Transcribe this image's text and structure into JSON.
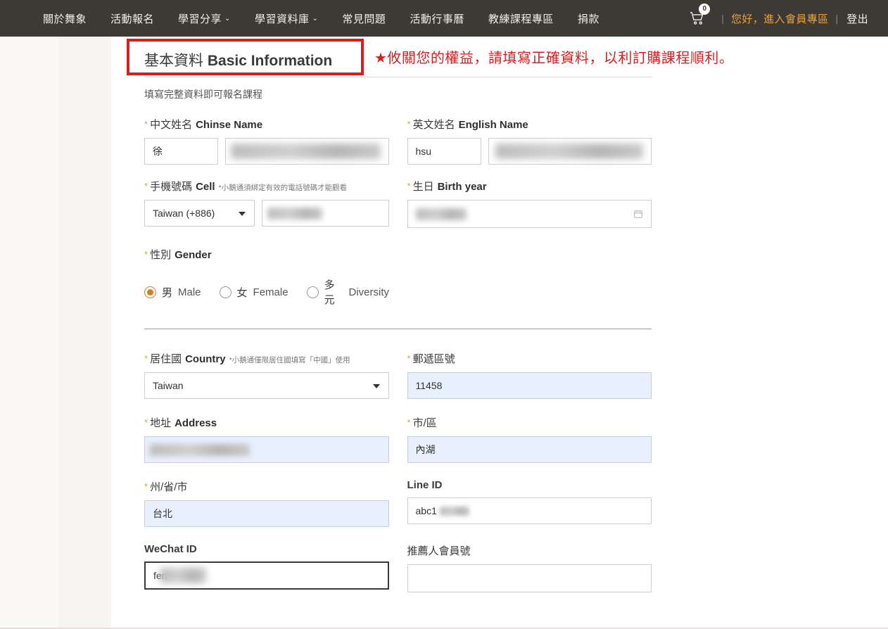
{
  "nav": {
    "items": [
      {
        "label": "關於舞象",
        "caret": false
      },
      {
        "label": "活動報名",
        "caret": false
      },
      {
        "label": "學習分享",
        "caret": true
      },
      {
        "label": "學習資料庫",
        "caret": true
      },
      {
        "label": "常見問題",
        "caret": false
      },
      {
        "label": "活動行事曆",
        "caret": false
      },
      {
        "label": "教練課程專區",
        "caret": false
      },
      {
        "label": "捐款",
        "caret": false
      }
    ],
    "caret_glyph": "⌄",
    "cart_icon": "shopping-cart-icon",
    "cart_count": "0",
    "separator": "|",
    "member_link": "您好，進入會員專區",
    "logout": "登出",
    "bg_color": "#3d3935",
    "member_color": "#e8a33d"
  },
  "section": {
    "title_cn": "基本資料",
    "title_en": "Basic Information",
    "notice": "★攸關您的權益，請填寫正確資料，以利訂購課程順利。",
    "notice_color": "#d81f1f",
    "subtitle": "填寫完整資料即可報名課程"
  },
  "form": {
    "chinese_name": {
      "required_mark": "*",
      "label_cn": "中文姓名",
      "label_en": "Chinse Name",
      "surname_value": "徐",
      "given_value": ""
    },
    "english_name": {
      "required_mark": "*",
      "label_cn": "英文姓名",
      "label_en": "English Name",
      "surname_value": "hsu",
      "given_value": ""
    },
    "cell": {
      "required_mark": "*",
      "label_cn": "手機號碼",
      "label_en": "Cell",
      "hint": "*小鵝通須綁定有效的電話號碼才能觀看",
      "country_code": "Taiwan (+886)",
      "number_value": ""
    },
    "birth_year": {
      "required_mark": "*",
      "label_cn": "生日",
      "label_en": "Birth year",
      "value": "",
      "icon": "calendar-icon"
    },
    "gender": {
      "required_mark": "*",
      "label_cn": "性別",
      "label_en": "Gender",
      "options": [
        {
          "cn": "男",
          "en": "Male",
          "selected": true
        },
        {
          "cn": "女",
          "en": "Female",
          "selected": false
        },
        {
          "cn": "多元",
          "en": "Diversity",
          "selected": false
        }
      ],
      "selected_color": "#d8801a"
    },
    "country": {
      "required_mark": "*",
      "label_cn": "居住國",
      "label_en": "Country",
      "hint": "*小鵝通僅限居住國填寫「中國」使用",
      "value": "Taiwan"
    },
    "postal_code": {
      "required_mark": "*",
      "label_cn": "郵遞區號",
      "value": "11458",
      "autofilled": true
    },
    "address": {
      "required_mark": "*",
      "label_cn": "地址",
      "label_en": "Address",
      "value": "",
      "autofilled": true
    },
    "city_district": {
      "required_mark": "*",
      "label_cn": "市/區",
      "value": "內湖",
      "autofilled": true
    },
    "state_province": {
      "required_mark": "*",
      "label_cn": "州/省/市",
      "value": "台北",
      "autofilled": true
    },
    "line_id": {
      "label": "Line ID",
      "value": "abc1"
    },
    "wechat_id": {
      "label": "WeChat ID",
      "value": "fen",
      "focused": true
    },
    "referrer_member_no": {
      "label": "推薦人會員號",
      "value": ""
    }
  }
}
